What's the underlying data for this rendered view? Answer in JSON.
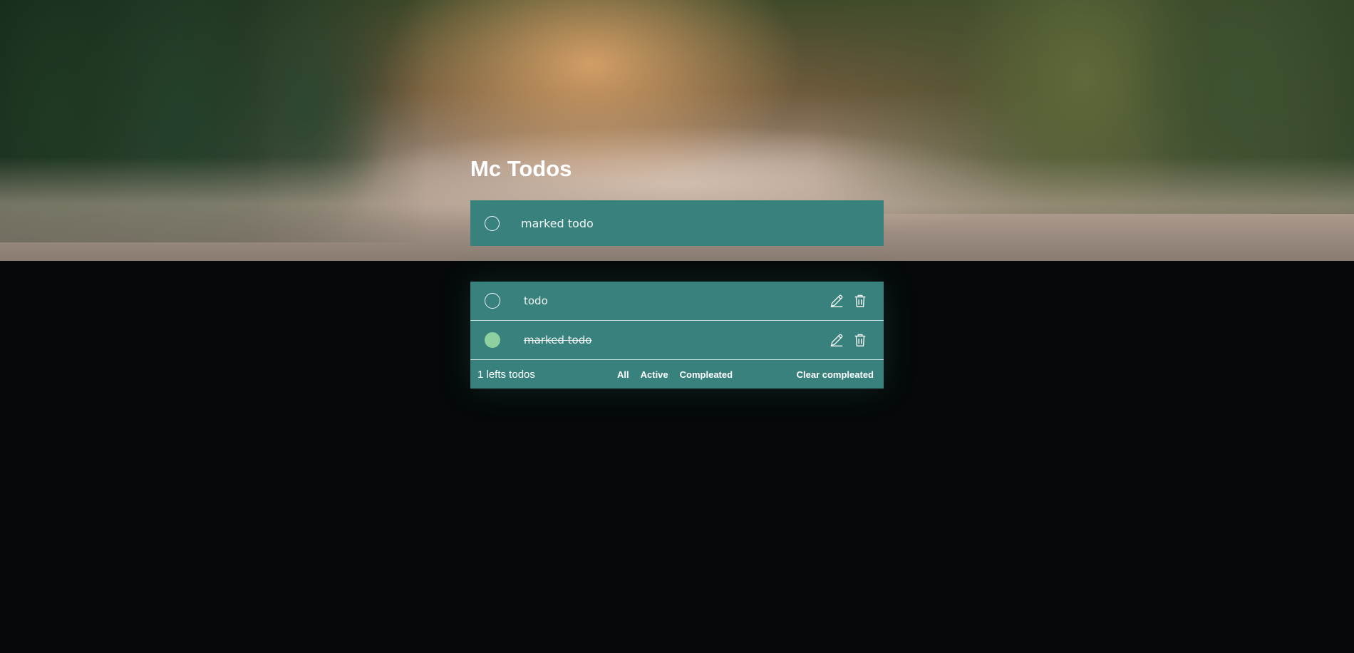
{
  "app": {
    "title_bold": "Mc",
    "title_rest": "Todos"
  },
  "new_todo": {
    "value": "marked todo"
  },
  "todos": [
    {
      "text": "todo",
      "completed": false
    },
    {
      "text": "marked todo",
      "completed": true
    }
  ],
  "footer": {
    "count_text": "1 lefts todos",
    "filters": [
      "All",
      "Active",
      "Compleated"
    ],
    "clear_label": "Clear compleated"
  },
  "icons": {
    "edit": "pencil-icon",
    "delete": "trash-icon"
  },
  "colors": {
    "card": "#38817d",
    "completed_check": "#8fd0a0",
    "page_bg": "#050909"
  }
}
